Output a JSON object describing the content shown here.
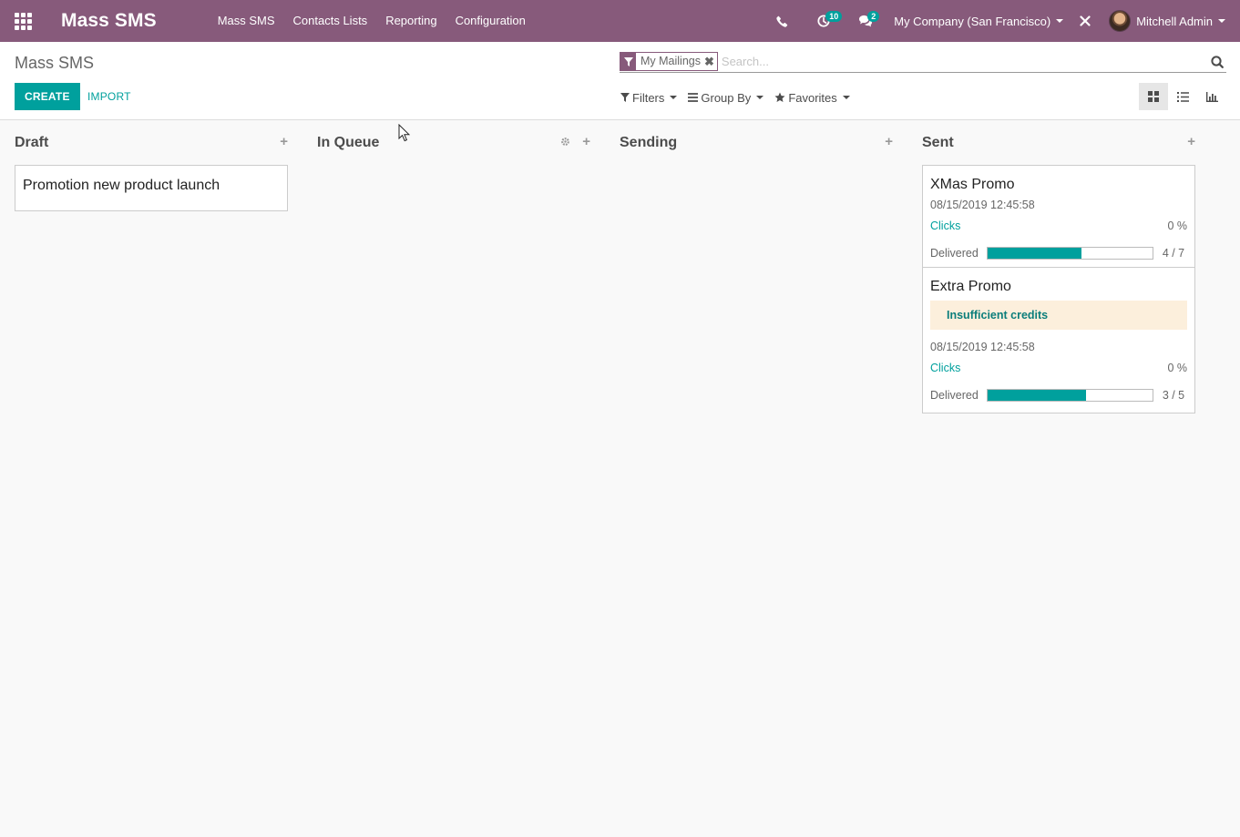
{
  "navbar": {
    "app_name": "Mass SMS",
    "menu": [
      "Mass SMS",
      "Contacts Lists",
      "Reporting",
      "Configuration"
    ],
    "activity_count": "10",
    "messages_count": "2",
    "company": "My Company (San Francisco)",
    "user": "Mitchell Admin",
    "bg_color": "#875a7b"
  },
  "control_panel": {
    "breadcrumb": "Mass SMS",
    "create_label": "CREATE",
    "import_label": "IMPORT",
    "search": {
      "facet": "My Mailings",
      "placeholder": "Search..."
    },
    "filters_label": "Filters",
    "group_by_label": "Group By",
    "favorites_label": "Favorites",
    "accent_color": "#00a09d"
  },
  "kanban": {
    "columns": [
      {
        "title": "Draft",
        "cards": [
          {
            "title": "Promotion new product launch"
          }
        ]
      },
      {
        "title": "In Queue",
        "cards": []
      },
      {
        "title": "Sending",
        "cards": []
      },
      {
        "title": "Sent",
        "cards": [
          {
            "title": "XMas Promo",
            "date": "08/15/2019 12:45:58",
            "clicks_label": "Clicks",
            "clicks_value": "0 %",
            "delivered_label": "Delivered",
            "delivered_value": "4 / 7",
            "delivered_fraction": 0.57
          },
          {
            "title": "Extra Promo",
            "alert": "Insufficient credits",
            "date": "08/15/2019 12:45:58",
            "clicks_label": "Clicks",
            "clicks_value": "0 %",
            "delivered_label": "Delivered",
            "delivered_value": "3 / 5",
            "delivered_fraction": 0.6
          }
        ]
      }
    ]
  }
}
